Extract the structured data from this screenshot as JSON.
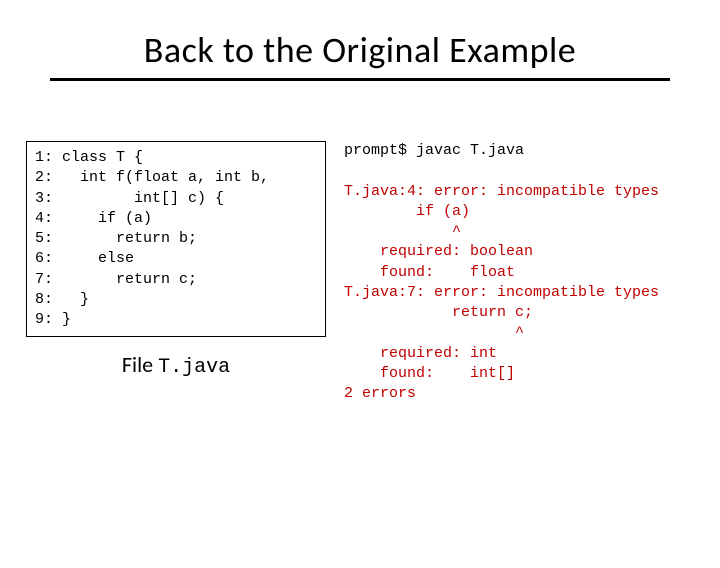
{
  "title": "Back to the Original Example",
  "code": "1: class T {\n2:   int f(float a, int b,\n3:         int[] c) {\n4:     if (a)\n5:       return b;\n6:     else\n7:       return c;\n8:   }\n9: }",
  "caption_prefix": "File ",
  "caption_file": "T.java",
  "terminal": {
    "cmd": "prompt$ javac T.java",
    "err": "T.java:4: error: incompatible types\n        if (a)\n            ^\n    required: boolean\n    found:    float\nT.java:7: error: incompatible types\n            return c;\n                   ^\n    required: int\n    found:    int[]\n2 errors"
  }
}
